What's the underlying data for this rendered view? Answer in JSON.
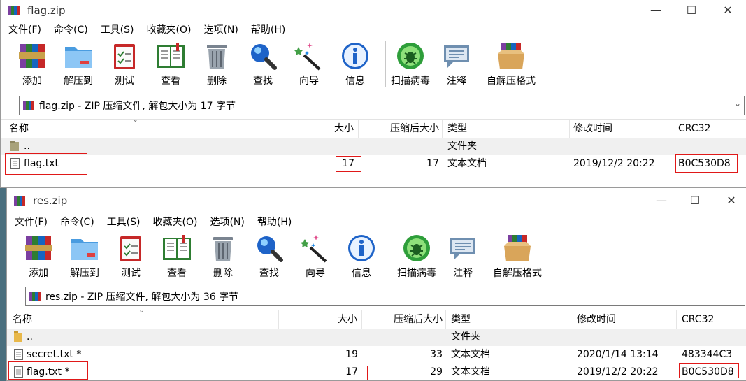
{
  "toolbar_items": [
    {
      "label": "添加",
      "icon": "add-books-icon"
    },
    {
      "label": "解压到",
      "icon": "extract-folder-icon"
    },
    {
      "label": "测试",
      "icon": "test-clipboard-icon"
    },
    {
      "label": "查看",
      "icon": "view-book-icon"
    },
    {
      "label": "删除",
      "icon": "trash-can-icon"
    },
    {
      "label": "查找",
      "icon": "magnifier-icon"
    },
    {
      "label": "向导",
      "icon": "magic-wand-icon"
    },
    {
      "label": "信息",
      "icon": "info-icon"
    },
    {
      "label": "扫描病毒",
      "icon": "virus-scan-icon"
    },
    {
      "label": "注释",
      "icon": "comment-bubble-icon"
    },
    {
      "label": "自解压格式",
      "icon": "sfx-box-icon"
    }
  ],
  "menus": [
    "文件(F)",
    "命令(C)",
    "工具(S)",
    "收藏夹(O)",
    "选项(N)",
    "帮助(H)"
  ],
  "columns": {
    "name": "名称",
    "size": "大小",
    "packed": "压缩后大小",
    "type": "类型",
    "modified": "修改时间",
    "crc": "CRC32"
  },
  "window_controls": {
    "minimize": "—",
    "maximize": "☐",
    "close": "✕"
  },
  "windows": [
    {
      "title": "flag.zip",
      "address": "flag.zip - ZIP 压缩文件, 解包大小为 17 字节",
      "rows": [
        {
          "name": "..",
          "size": "",
          "packed": "",
          "type": "文件夹",
          "modified": "",
          "crc": "",
          "kind": "folder"
        },
        {
          "name": "flag.txt",
          "size": "17",
          "packed": "17",
          "type": "文本文档",
          "modified": "2019/12/2 20:22",
          "crc": "B0C530D8",
          "kind": "file"
        }
      ]
    },
    {
      "title": "res.zip",
      "address": "res.zip - ZIP 压缩文件, 解包大小为 36 字节",
      "rows": [
        {
          "name": "..",
          "size": "",
          "packed": "",
          "type": "文件夹",
          "modified": "",
          "crc": "",
          "kind": "folder"
        },
        {
          "name": "secret.txt *",
          "size": "19",
          "packed": "33",
          "type": "文本文档",
          "modified": "2020/1/14 13:14",
          "crc": "483344C3",
          "kind": "file"
        },
        {
          "name": "flag.txt *",
          "size": "17",
          "packed": "29",
          "type": "文本文档",
          "modified": "2019/12/2 20:22",
          "crc": "B0C530D8",
          "kind": "file"
        }
      ]
    }
  ],
  "colors": {
    "highlight": "#e01818",
    "row_alt": "#f0f0f0",
    "desktop": "#4a6f7e"
  }
}
